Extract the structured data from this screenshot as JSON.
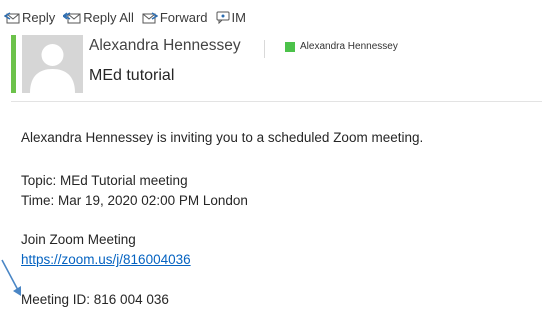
{
  "toolbar": {
    "reply": "Reply",
    "reply_all": "Reply All",
    "forward": "Forward",
    "im": "IM"
  },
  "header": {
    "sender": "Alexandra Hennessey",
    "category_label": "Alexandra Hennessey",
    "subject": "MEd tutorial",
    "accent_color": "#6cc24a",
    "category_color": "#4cc24a"
  },
  "body": {
    "intro": "Alexandra Hennessey is inviting you to a scheduled Zoom meeting.",
    "topic": "Topic: MEd Tutorial meeting",
    "time": "Time: Mar 19, 2020 02:00 PM London",
    "join_label": "Join Zoom Meeting",
    "join_link": "https://zoom.us/j/816004036",
    "meeting_id": "Meeting ID: 816 004 036"
  },
  "annotation": {
    "arrow_color": "#4a86c5"
  }
}
